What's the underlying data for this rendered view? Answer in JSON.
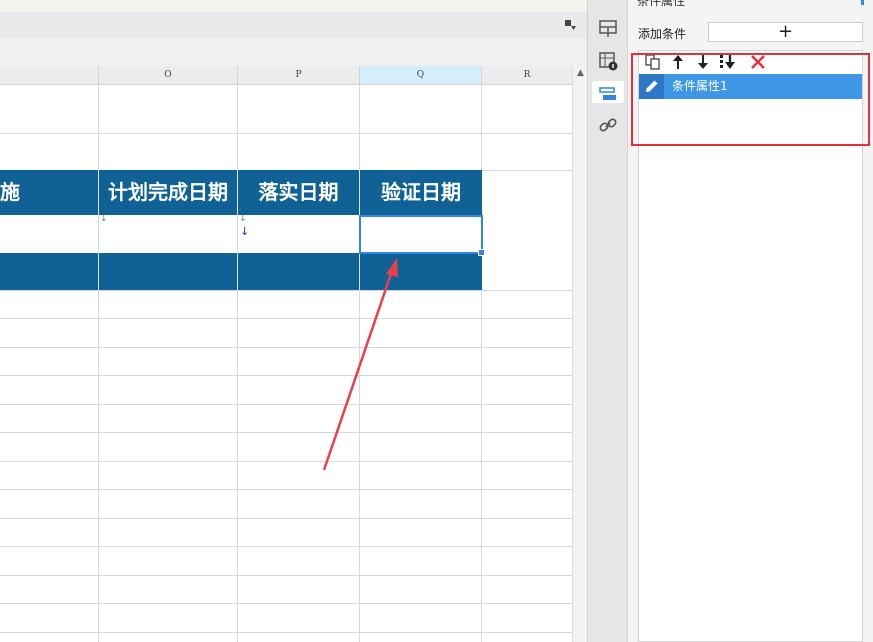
{
  "sheet": {
    "columns": [
      "O",
      "P",
      "Q",
      "R"
    ],
    "selected_column": "Q",
    "header_cells": [
      "施",
      "计划完成日期",
      "落实日期",
      "验证日期"
    ],
    "header_bg": "#0f6196",
    "selection_color": "#2f86e6"
  },
  "annotation": {
    "box_color": "#e0303c",
    "arrow_color": "#e8404c"
  },
  "side_rail": {
    "icons": [
      "layout-icon",
      "cell-attribute-icon",
      "condition-attribute-icon",
      "hyperlink-icon"
    ],
    "active": "condition-attribute-icon"
  },
  "panel": {
    "title": "条件属性",
    "add_label": "添加条件",
    "add_button": "+",
    "tools": [
      "copy-icon",
      "move-up-icon",
      "move-down-icon",
      "move-bottom-icon",
      "delete-icon"
    ],
    "conditions": [
      {
        "label": "条件属性1"
      }
    ]
  }
}
